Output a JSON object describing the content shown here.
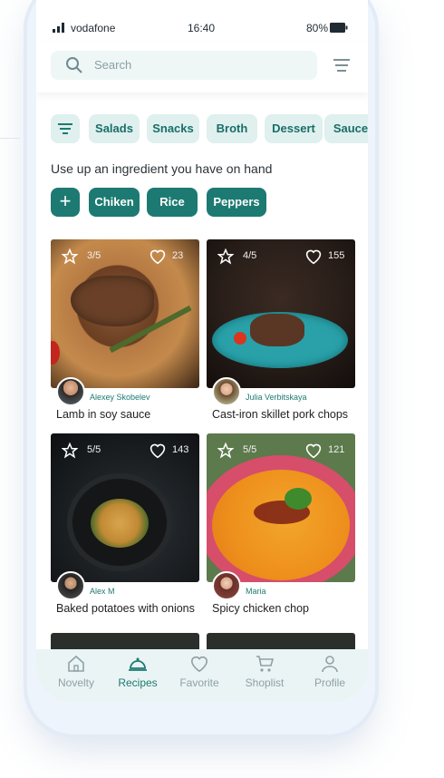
{
  "status": {
    "carrier": "vodafone",
    "time": "16:40",
    "battery": "80%"
  },
  "search": {
    "placeholder": "Search"
  },
  "categories": [
    "Salads",
    "Snacks",
    "Broth",
    "Dessert",
    "Sauce"
  ],
  "ingredients_heading": "Use up an  ingredient you have on hand",
  "ingredients": [
    "Chiken",
    "Rice",
    "Peppers"
  ],
  "recipes": [
    {
      "title": "Lamb in soy sauce",
      "author": "Alexey Skobelev",
      "rating": "3/5",
      "likes": "23"
    },
    {
      "title": "Cast-iron skillet pork chops",
      "author": "Julia Verbitskaya",
      "rating": "4/5",
      "likes": "155"
    },
    {
      "title": "Baked potatoes with onions",
      "author": "Alex M",
      "rating": "5/5",
      "likes": "143"
    },
    {
      "title": "Spicy chicken chop",
      "author": "Maria",
      "rating": "5/5",
      "likes": "121"
    }
  ],
  "nav": [
    "Novelty",
    "Recipes",
    "Favorite",
    "Shoplist",
    "Profile"
  ],
  "colors": {
    "accent": "#1d7a72",
    "chip_bg": "#dff0ee",
    "nav_bg": "#eaf4f4"
  }
}
